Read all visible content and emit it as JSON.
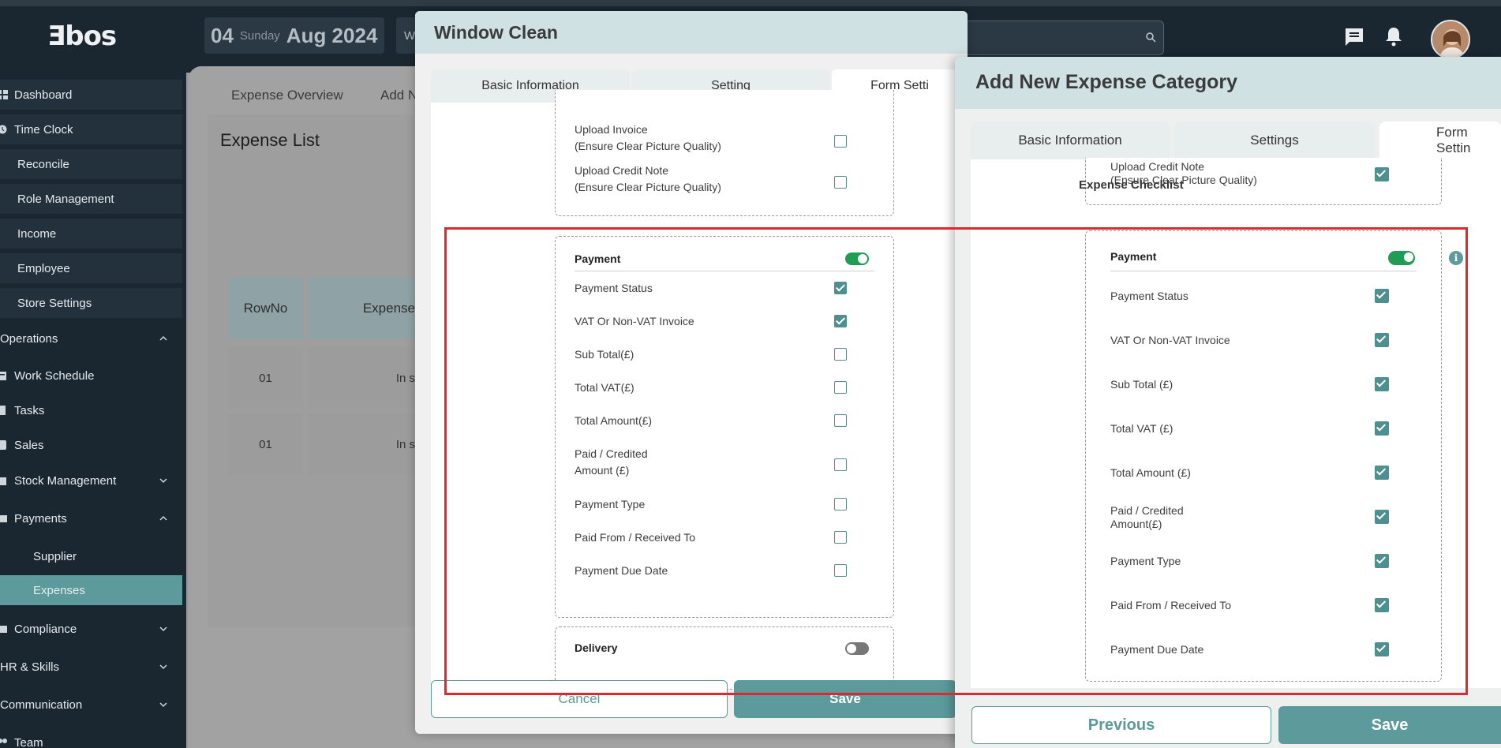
{
  "app": {
    "logo": "Ǝbos"
  },
  "header": {
    "date_day": "04",
    "date_weekday": "Sunday",
    "date_month_year": "Aug 2024",
    "w_label": "W"
  },
  "sidebar": {
    "items": [
      {
        "label": "Dashboard",
        "icon": "grid-icon"
      },
      {
        "label": "Time Clock",
        "icon": "clock-icon"
      },
      {
        "label": "Reconcile"
      },
      {
        "label": "Role Management"
      },
      {
        "label": "Income"
      },
      {
        "label": "Employee"
      },
      {
        "label": "Store Settings"
      },
      {
        "label": "Operations"
      },
      {
        "label": "Work Schedule",
        "icon": "calendar-icon"
      },
      {
        "label": "Tasks",
        "icon": "clipboard-icon"
      },
      {
        "label": "Sales",
        "icon": "tag-icon"
      },
      {
        "label": "Stock Management",
        "icon": "box-icon"
      },
      {
        "label": "Payments",
        "icon": "money-icon"
      },
      {
        "label": "Supplier"
      },
      {
        "label": "Expenses"
      },
      {
        "label": "Compliance",
        "icon": "shield-icon"
      },
      {
        "label": "HR & Skills"
      },
      {
        "label": "Communication"
      },
      {
        "label": "Team",
        "icon": "team-icon"
      }
    ]
  },
  "main": {
    "tabs": [
      "Expense Overview",
      "Add N"
    ],
    "list_title": "Expense List",
    "table": {
      "headers": [
        "RowNo",
        "Expense"
      ],
      "rows": [
        [
          "01",
          "In s"
        ],
        [
          "01",
          "In s"
        ]
      ]
    }
  },
  "modal1": {
    "title": "Window Clean",
    "tabs": [
      "Basic Information",
      "Setting",
      "Form Setti"
    ],
    "upload_invoice": "Upload Invoice\n(Ensure Clear Picture Quality)",
    "upload_credit": "Upload Credit Note\n(Ensure Clear Picture Quality)",
    "payment_title": "Payment",
    "rows": [
      {
        "label": "Payment Status",
        "checked": true
      },
      {
        "label": "VAT Or Non-VAT Invoice",
        "checked": true
      },
      {
        "label": "Sub Total(£)",
        "checked": false
      },
      {
        "label": "Total VAT(£)",
        "checked": false
      },
      {
        "label": "Total Amount(£)",
        "checked": false
      },
      {
        "label": "Paid / Credited\nAmount (£)",
        "checked": false
      },
      {
        "label": "Payment Type",
        "checked": false
      },
      {
        "label": "Paid From / Received To",
        "checked": false
      },
      {
        "label": "Payment Due Date",
        "checked": false
      }
    ],
    "delivery_title": "Delivery",
    "cancel": "Cancel",
    "save": "Save"
  },
  "modal2": {
    "title": "Add New Expense Category",
    "tabs": [
      "Basic Information",
      "Settings",
      "Form Settin"
    ],
    "upload_credit": "Upload Credit Note\n(Ensure Clear Picture Quality)",
    "checklist_label": "Expense Checklist",
    "payment_title": "Payment",
    "rows": [
      {
        "label": "Payment Status",
        "checked": true
      },
      {
        "label": "VAT Or Non-VAT Invoice",
        "checked": true
      },
      {
        "label": "Sub Total (£)",
        "checked": true
      },
      {
        "label": "Total VAT (£)",
        "checked": true
      },
      {
        "label": "Total Amount (£)",
        "checked": true
      },
      {
        "label": "Paid / Credited\nAmount(£)",
        "checked": true
      },
      {
        "label": "Payment Type",
        "checked": true
      },
      {
        "label": "Paid From / Received To",
        "checked": true
      },
      {
        "label": "Payment Due Date",
        "checked": true
      }
    ],
    "previous": "Previous",
    "save": "Save"
  },
  "colors": {
    "accent": "#5c9a9b",
    "highlight": "#e3262b",
    "toggle_on": "#1f9d55"
  }
}
